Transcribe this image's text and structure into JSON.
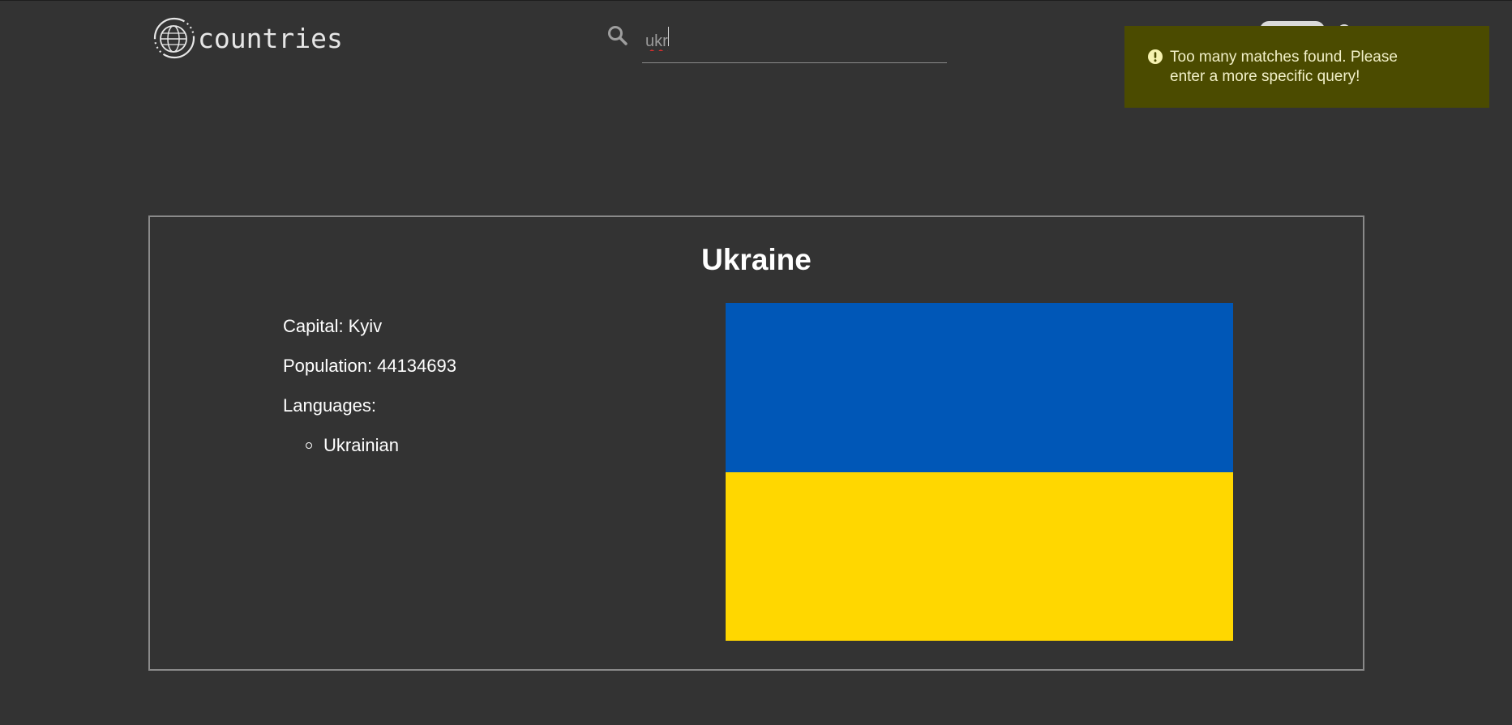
{
  "app": {
    "logo_text": "countries"
  },
  "search": {
    "value": "ukr"
  },
  "notification": {
    "message": "Too many matches found. Please enter a more specific query!"
  },
  "country": {
    "name": "Ukraine",
    "capital_label": "Capital:",
    "capital": "Kyiv",
    "population_label": "Population:",
    "population": "44134693",
    "languages_label": "Languages:",
    "languages": [
      "Ukrainian"
    ]
  },
  "colors": {
    "background": "#333333",
    "notification_bg": "#4b4b00",
    "flag_blue": "#0057b7",
    "flag_yellow": "#ffd700"
  },
  "icons": {
    "logo": "globe-icon",
    "search": "search-icon",
    "notification": "exclamation-circle-icon",
    "list_bullet": "circle-bullet-icon"
  }
}
